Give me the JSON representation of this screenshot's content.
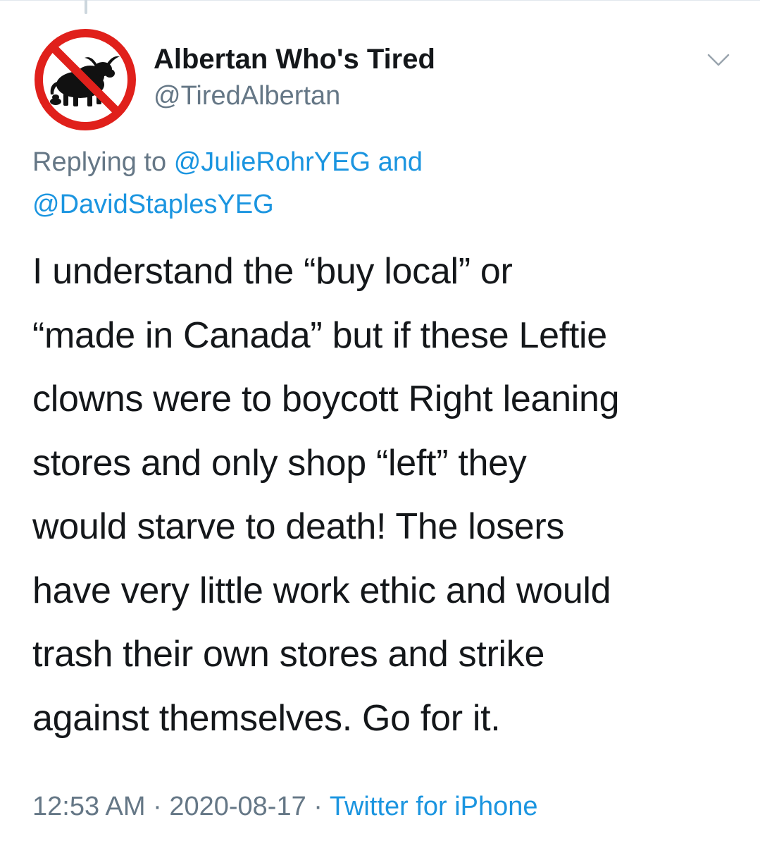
{
  "tweet": {
    "author": {
      "display_name": "Albertan Who's Tired",
      "handle": "@TiredAlbertan",
      "avatar_icon": "no-bull-prohibition-icon"
    },
    "reply": {
      "prefix": "Replying to",
      "mention_1": "@JulieRohrYEG",
      "conjunction": "and",
      "mention_2": "@DavidStaplesYEG"
    },
    "text_lines": [
      "I understand the “buy local” or",
      "“made in Canada” but if these Leftie",
      "clowns were to boycott Right leaning",
      "stores and only shop “left” they",
      "would starve to death! The losers",
      "have very little work ethic and would",
      "trash their own stores and strike",
      "against themselves. Go for it."
    ],
    "time": "12:53 AM",
    "separator": "·",
    "date": "2020-08-17",
    "source": "Twitter for iPhone"
  },
  "colors": {
    "text": "#14171a",
    "secondary": "#657786",
    "link": "#1b95e0",
    "prohibition_red": "#e0201b"
  },
  "icons": {
    "menu": "chevron-down-icon"
  }
}
